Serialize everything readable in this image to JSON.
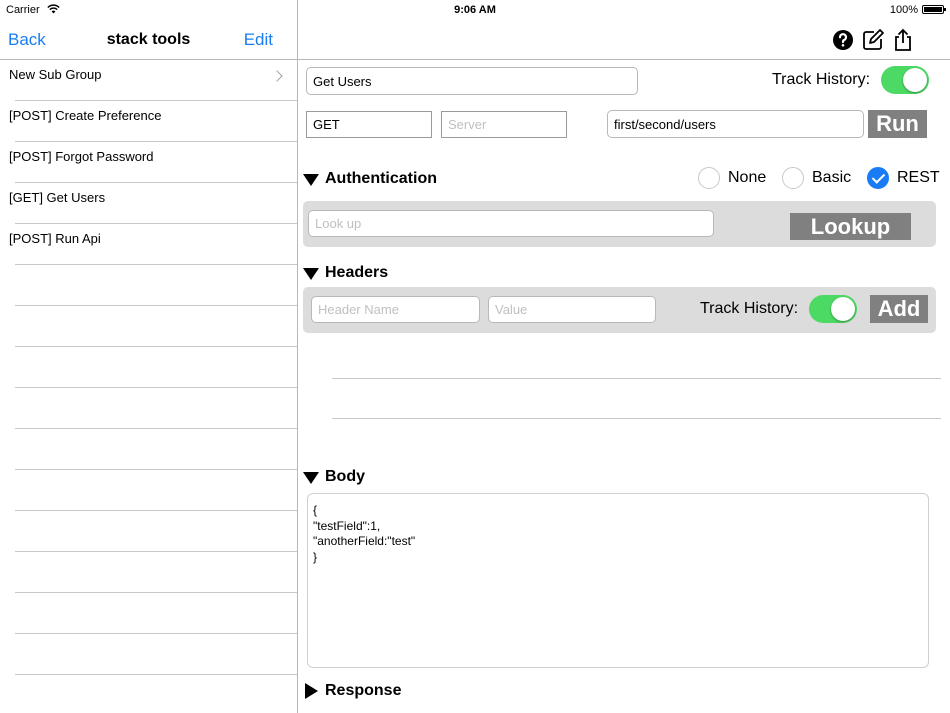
{
  "status": {
    "carrier": "Carrier",
    "time": "9:06 AM",
    "battery": "100%"
  },
  "nav": {
    "back": "Back",
    "title": "stack tools",
    "edit": "Edit"
  },
  "groups": [
    "New Sub Group",
    "[POST] Create Preference",
    "[POST] Forgot Password",
    "[GET] Get Users",
    "[POST] Run Api"
  ],
  "request": {
    "name": "Get Users",
    "track_history_label": "Track History:",
    "method": "GET",
    "server_placeholder": "Server",
    "path": "first/second/users",
    "run_label": "Run"
  },
  "auth": {
    "title": "Authentication",
    "options": [
      "None",
      "Basic",
      "REST"
    ],
    "selected": "REST",
    "lookup_placeholder": "Look up",
    "lookup_label": "Lookup"
  },
  "headers": {
    "title": "Headers",
    "name_placeholder": "Header Name",
    "value_placeholder": "Value",
    "track_history_label": "Track History:",
    "add_label": "Add"
  },
  "body": {
    "title": "Body",
    "text": "{\n\"testField\":1,\n\"anotherField:\"test\"\n}"
  },
  "response": {
    "title": "Response"
  },
  "colors": {
    "accent": "#1a7cf5",
    "switch_on": "#4cd964",
    "button_gray": "#808080"
  }
}
